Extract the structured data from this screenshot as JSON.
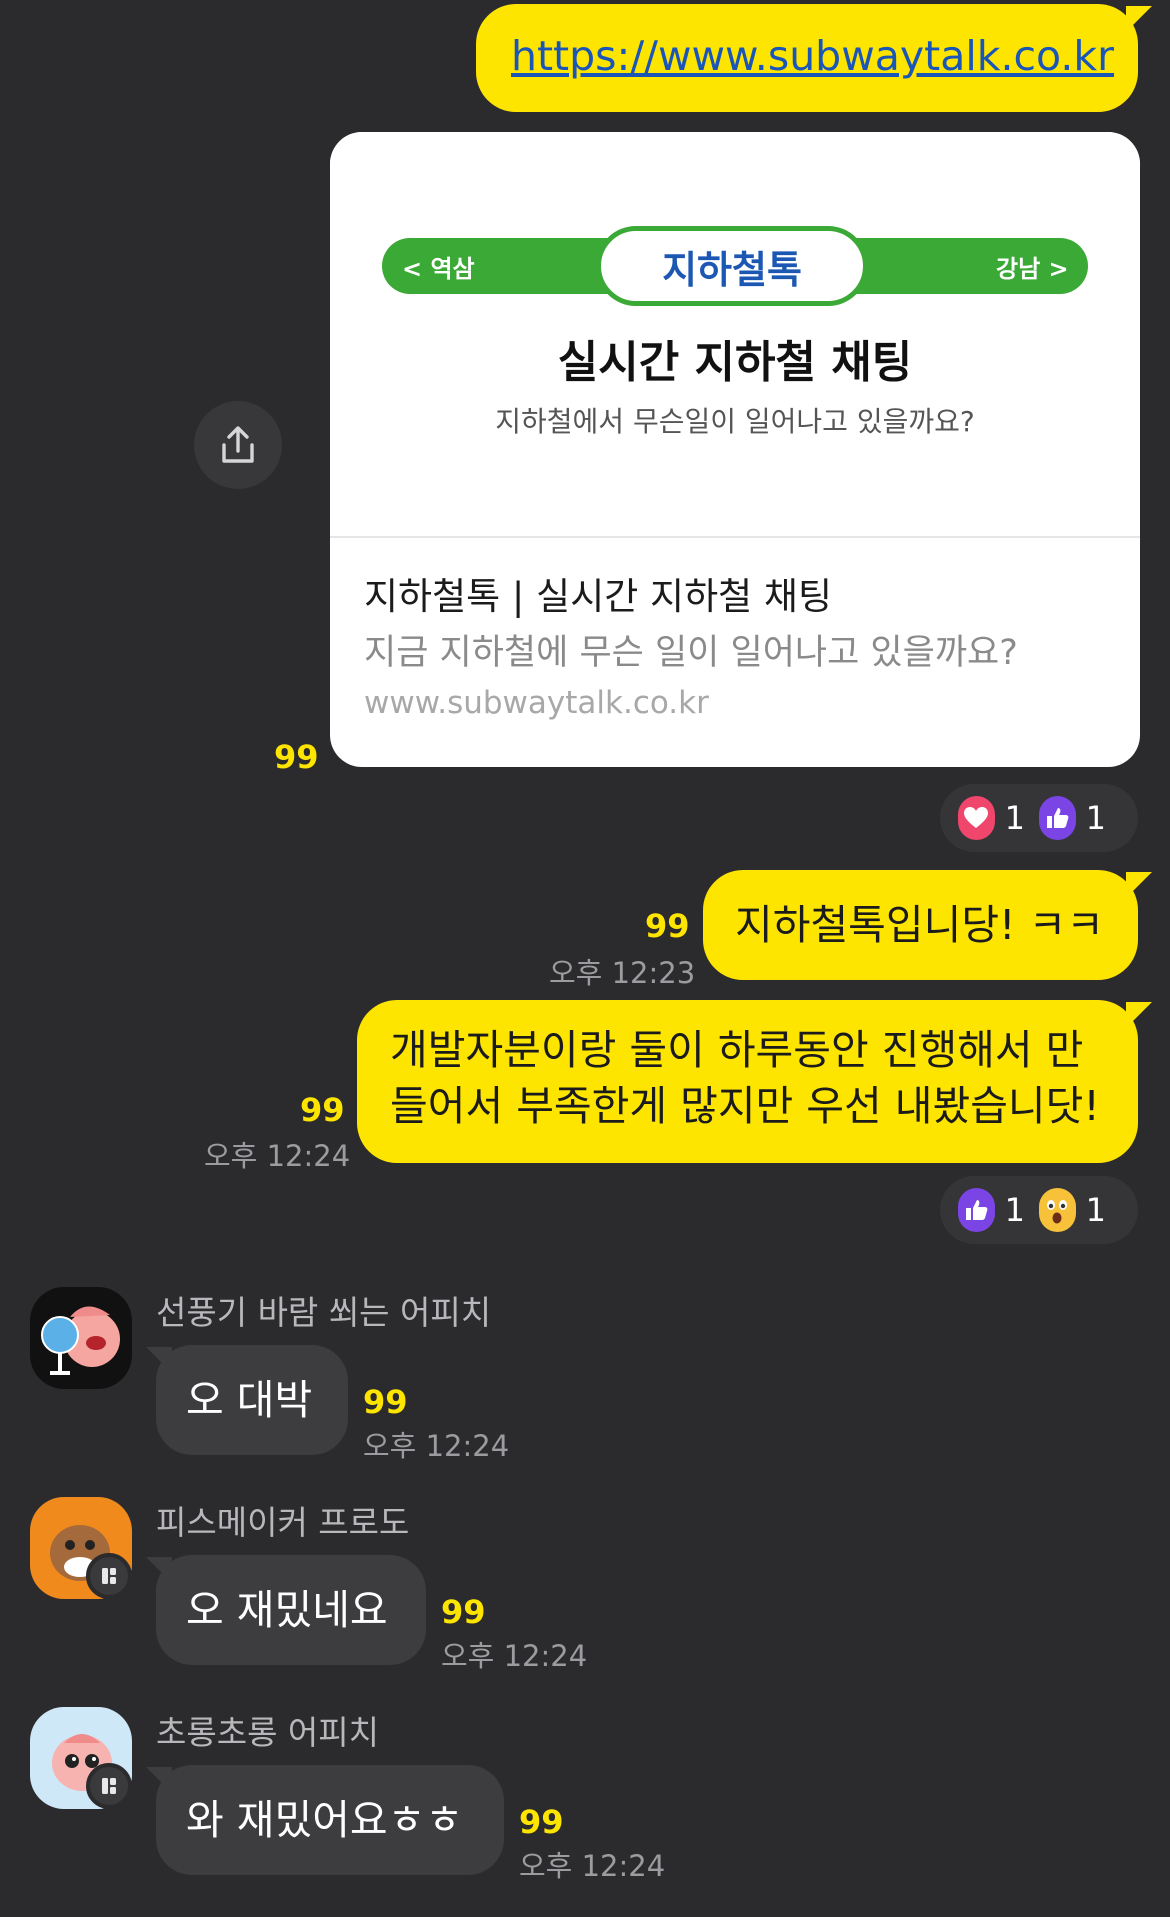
{
  "messages_mine": [
    {
      "link_text": "https://www.subwaytalk.co.kr"
    },
    {
      "text": "지하철톡입니당! ㅋㅋ",
      "count": "99",
      "time": "오후 12:23"
    },
    {
      "lines": [
        "개발자분이랑 둘이 하루동안 진행해서 만",
        "들어서 부족한게 많지만 우선 내봤습니닷!"
      ],
      "count": "99",
      "time": "오후 12:24"
    }
  ],
  "link_preview": {
    "banner_left": "< 역삼",
    "banner_center": "지하철톡",
    "banner_right": "강남 >",
    "hero_title": "실시간 지하철 채팅",
    "hero_subtitle": "지하철에서 무슨일이 일어나고 있을까요?",
    "title": "지하철톡 | 실시간 지하철 채팅",
    "description": "지금 지하철에 무슨 일이 일어나고 있을까요?",
    "domain": "www.subwaytalk.co.kr",
    "count": "99",
    "share_icon": "share-icon"
  },
  "reactions": [
    [
      {
        "icon": "heart-icon",
        "count": "1"
      },
      {
        "icon": "thumbs-up-icon",
        "count": "1"
      }
    ],
    [
      {
        "icon": "thumbs-up-icon",
        "count": "1"
      },
      {
        "icon": "surprised-face-icon",
        "count": "1"
      }
    ]
  ],
  "messages_other": [
    {
      "sender": "선풍기 바람 쐬는 어피치",
      "text": "오 대박",
      "count": "99",
      "time": "오후 12:24"
    },
    {
      "sender": "피스메이커 프로도",
      "text": "오 재밌네요",
      "count": "99",
      "time": "오후 12:24"
    },
    {
      "sender": "초롱초롱 어피치",
      "text": "와 재밌어요ㅎㅎ",
      "count": "99",
      "time": "오후 12:24"
    }
  ],
  "colors": {
    "background": "#2b2b2d",
    "my_bubble": "#fee500",
    "other_bubble": "#3d3d40",
    "unread_count": "#fee500",
    "banner_green": "#3aa935",
    "link_blue": "#1a55b8"
  }
}
